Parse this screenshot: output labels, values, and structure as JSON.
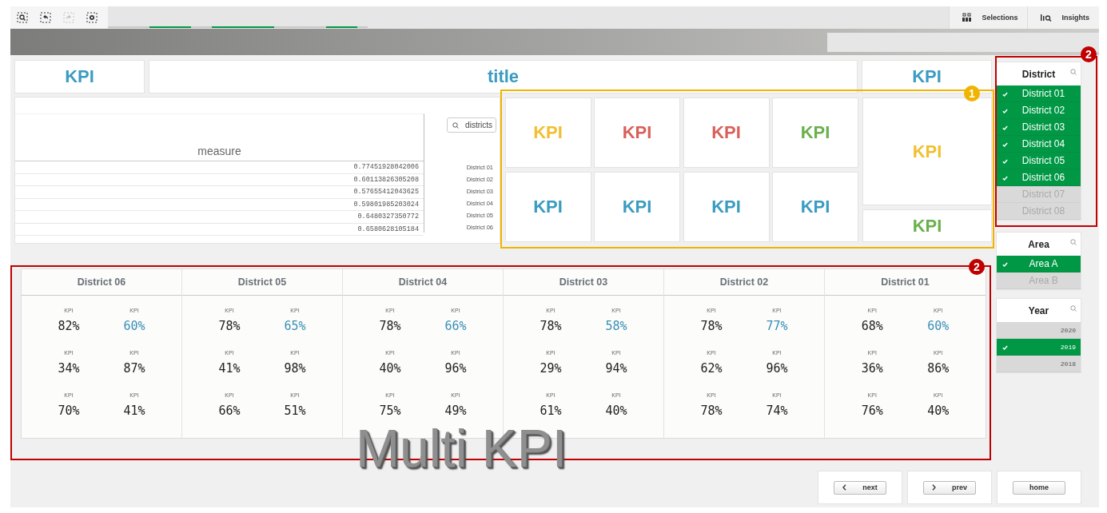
{
  "toolbar": {
    "tools": [
      {
        "kind": "zoom",
        "disabled": false
      },
      {
        "kind": "back",
        "disabled": false
      },
      {
        "kind": "forward",
        "disabled": true
      },
      {
        "kind": "clear",
        "disabled": false
      }
    ],
    "progress": [
      {
        "on": false
      },
      {
        "on": false
      },
      {
        "on": false
      },
      {
        "on": false
      },
      {
        "on": true
      },
      {
        "on": true
      },
      {
        "on": true
      },
      {
        "on": true
      },
      {
        "on": false
      },
      {
        "on": false
      },
      {
        "on": true
      },
      {
        "on": true
      },
      {
        "on": true
      },
      {
        "on": true
      },
      {
        "on": true
      },
      {
        "on": true
      },
      {
        "on": false
      },
      {
        "on": false
      },
      {
        "on": false
      },
      {
        "on": false
      },
      {
        "on": false
      },
      {
        "on": true
      },
      {
        "on": true
      },
      {
        "on": true
      },
      {
        "on": false
      }
    ],
    "tabs": [
      {
        "kind": "selections",
        "label": "Selections"
      },
      {
        "kind": "insights",
        "label": "Insights"
      }
    ]
  },
  "top_row": {
    "kpi_left": {
      "text": "KPI",
      "color": "#3b9cc0"
    },
    "title": "title",
    "kpi_right": {
      "text": "KPI",
      "color": "#3b9cc0"
    }
  },
  "table": {
    "column": "measure",
    "search": {
      "value": "districts"
    },
    "rows": [
      {
        "value": "0.77451928042006",
        "label": "District 01"
      },
      {
        "value": "0.60113826305208",
        "label": "District 02"
      },
      {
        "value": "0.57655412043625",
        "label": "District 03"
      },
      {
        "value": "0.59801985203024",
        "label": "District 04"
      },
      {
        "value": "0.6480327350772",
        "label": "District 05"
      },
      {
        "value": "0.6580628105184",
        "label": "District 06"
      }
    ]
  },
  "kpi_grid": [
    {
      "text": "KPI",
      "color": "#f0c030"
    },
    {
      "text": "KPI",
      "color": "#d9605a"
    },
    {
      "text": "KPI",
      "color": "#d9605a"
    },
    {
      "text": "KPI",
      "color": "#6ab04c"
    },
    {
      "text": "KPI",
      "color": "#3b9cc0"
    },
    {
      "text": "KPI",
      "color": "#3b9cc0"
    },
    {
      "text": "KPI",
      "color": "#3b9cc0"
    },
    {
      "text": "KPI",
      "color": "#3b9cc0"
    }
  ],
  "kpi_big": {
    "text": "KPI",
    "color": "#f0c030"
  },
  "kpi_small": {
    "text": "KPI",
    "color": "#6ab04c"
  },
  "multi_kpi": {
    "columns": [
      {
        "name": "District 06",
        "cells": [
          {
            "label": "KPI",
            "value": "82%",
            "color": "#222222"
          },
          {
            "label": "KPI",
            "value": "60%",
            "color": "#3a8fb7"
          },
          {
            "label": "KPI",
            "value": "34%",
            "color": "#222222"
          },
          {
            "label": "KPI",
            "value": "87%",
            "color": "#222222"
          },
          {
            "label": "KPI",
            "value": "70%",
            "color": "#222222"
          },
          {
            "label": "KPI",
            "value": "41%",
            "color": "#222222"
          }
        ]
      },
      {
        "name": "District 05",
        "cells": [
          {
            "label": "KPI",
            "value": "78%",
            "color": "#222222"
          },
          {
            "label": "KPI",
            "value": "65%",
            "color": "#3a8fb7"
          },
          {
            "label": "KPI",
            "value": "41%",
            "color": "#222222"
          },
          {
            "label": "KPI",
            "value": "98%",
            "color": "#222222"
          },
          {
            "label": "KPI",
            "value": "66%",
            "color": "#222222"
          },
          {
            "label": "KPI",
            "value": "51%",
            "color": "#222222"
          }
        ]
      },
      {
        "name": "District 04",
        "cells": [
          {
            "label": "KPI",
            "value": "78%",
            "color": "#222222"
          },
          {
            "label": "KPI",
            "value": "66%",
            "color": "#3a8fb7"
          },
          {
            "label": "KPI",
            "value": "40%",
            "color": "#222222"
          },
          {
            "label": "KPI",
            "value": "96%",
            "color": "#222222"
          },
          {
            "label": "KPI",
            "value": "75%",
            "color": "#222222"
          },
          {
            "label": "KPI",
            "value": "49%",
            "color": "#222222"
          }
        ]
      },
      {
        "name": "District 03",
        "cells": [
          {
            "label": "KPI",
            "value": "78%",
            "color": "#222222"
          },
          {
            "label": "KPI",
            "value": "58%",
            "color": "#3a8fb7"
          },
          {
            "label": "KPI",
            "value": "29%",
            "color": "#222222"
          },
          {
            "label": "KPI",
            "value": "94%",
            "color": "#222222"
          },
          {
            "label": "KPI",
            "value": "61%",
            "color": "#222222"
          },
          {
            "label": "KPI",
            "value": "40%",
            "color": "#222222"
          }
        ]
      },
      {
        "name": "District 02",
        "cells": [
          {
            "label": "KPI",
            "value": "78%",
            "color": "#222222"
          },
          {
            "label": "KPI",
            "value": "77%",
            "color": "#3a8fb7"
          },
          {
            "label": "KPI",
            "value": "62%",
            "color": "#222222"
          },
          {
            "label": "KPI",
            "value": "96%",
            "color": "#222222"
          },
          {
            "label": "KPI",
            "value": "78%",
            "color": "#222222"
          },
          {
            "label": "KPI",
            "value": "74%",
            "color": "#222222"
          }
        ]
      },
      {
        "name": "District 01",
        "cells": [
          {
            "label": "KPI",
            "value": "68%",
            "color": "#222222"
          },
          {
            "label": "KPI",
            "value": "60%",
            "color": "#3a8fb7"
          },
          {
            "label": "KPI",
            "value": "36%",
            "color": "#222222"
          },
          {
            "label": "KPI",
            "value": "86%",
            "color": "#222222"
          },
          {
            "label": "KPI",
            "value": "76%",
            "color": "#222222"
          },
          {
            "label": "KPI",
            "value": "40%",
            "color": "#222222"
          }
        ]
      }
    ]
  },
  "filters": [
    {
      "title": "District",
      "kind": "text",
      "items": [
        {
          "label": "District 01",
          "selected": true
        },
        {
          "label": "District 02",
          "selected": true
        },
        {
          "label": "District 03",
          "selected": true
        },
        {
          "label": "District 04",
          "selected": true
        },
        {
          "label": "District 05",
          "selected": true
        },
        {
          "label": "District 06",
          "selected": true
        },
        {
          "label": "District 07",
          "selected": false
        },
        {
          "label": "District 08",
          "selected": false
        }
      ]
    },
    {
      "title": "Area",
      "kind": "text",
      "items": [
        {
          "label": "Area A",
          "selected": true
        },
        {
          "label": "Area B",
          "selected": false
        }
      ]
    },
    {
      "title": "Year",
      "kind": "mono",
      "items": [
        {
          "label": "2020",
          "selected": false
        },
        {
          "label": "2019",
          "selected": true
        },
        {
          "label": "2018",
          "selected": false
        }
      ]
    }
  ],
  "nav": [
    {
      "label": "next",
      "kind": "left"
    },
    {
      "label": "prev",
      "kind": "right"
    },
    {
      "label": "home",
      "kind": "none"
    }
  ],
  "annotations": [
    {
      "label": "1",
      "color": "#f0b400"
    },
    {
      "label": "2",
      "color": "#c00000"
    },
    {
      "label": "2",
      "color": "#c00000"
    }
  ],
  "overlay_title": "Multi KPI"
}
